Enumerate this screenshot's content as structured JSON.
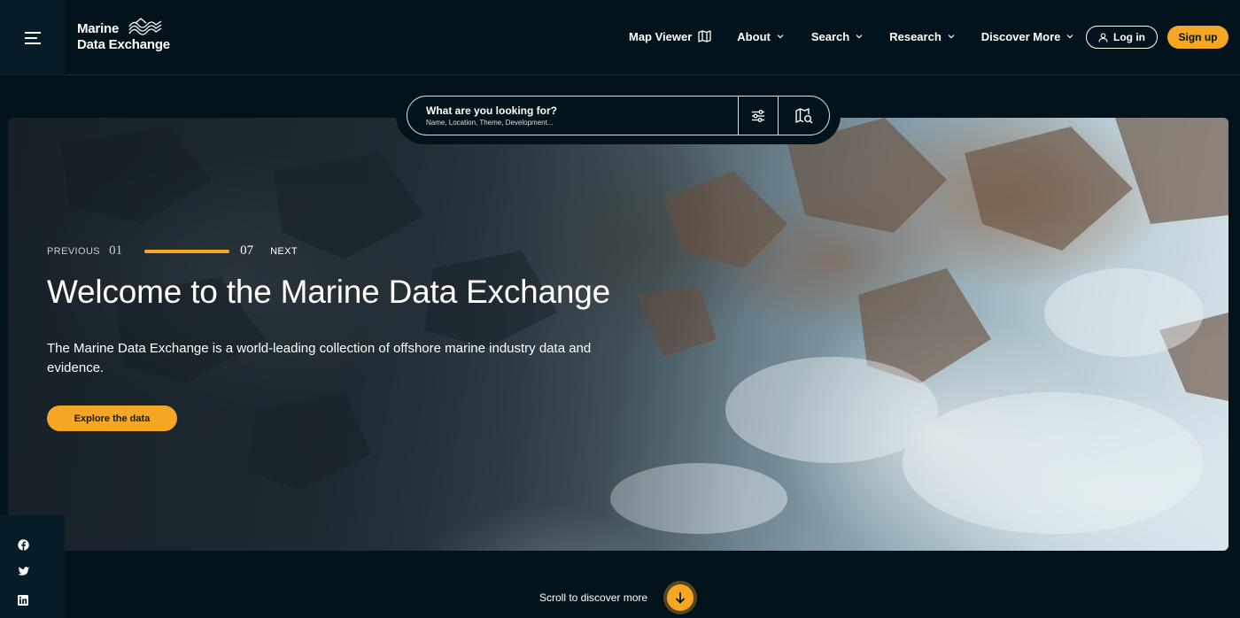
{
  "header": {
    "logo_line1": "Marine",
    "logo_line2": "Data Exchange",
    "nav": [
      {
        "label": "Map Viewer",
        "icon": "map-icon"
      },
      {
        "label": "About",
        "icon": "chevron-down-icon"
      },
      {
        "label": "Search",
        "icon": "chevron-down-icon"
      },
      {
        "label": "Research",
        "icon": "chevron-down-icon"
      },
      {
        "label": "Discover More",
        "icon": "chevron-down-icon"
      }
    ],
    "login_label": "Log in",
    "signup_label": "Sign up"
  },
  "search": {
    "label": "What are you looking for?",
    "hint": "Name, Location, Theme, Development..."
  },
  "hero": {
    "slider": {
      "prev_label": "PREVIOUS",
      "current": "01",
      "total": "07",
      "next_label": "NEXT"
    },
    "title": "Welcome to the Marine Data Exchange",
    "description": "The Marine Data Exchange is a world-leading collection of offshore marine industry data and evidence.",
    "cta_label": "Explore the data"
  },
  "social": [
    "facebook-icon",
    "twitter-icon",
    "linkedin-icon"
  ],
  "scroll_label": "Scroll to discover more",
  "colors": {
    "background": "#03131c",
    "accent": "#f5a623",
    "panel": "#071c27"
  }
}
